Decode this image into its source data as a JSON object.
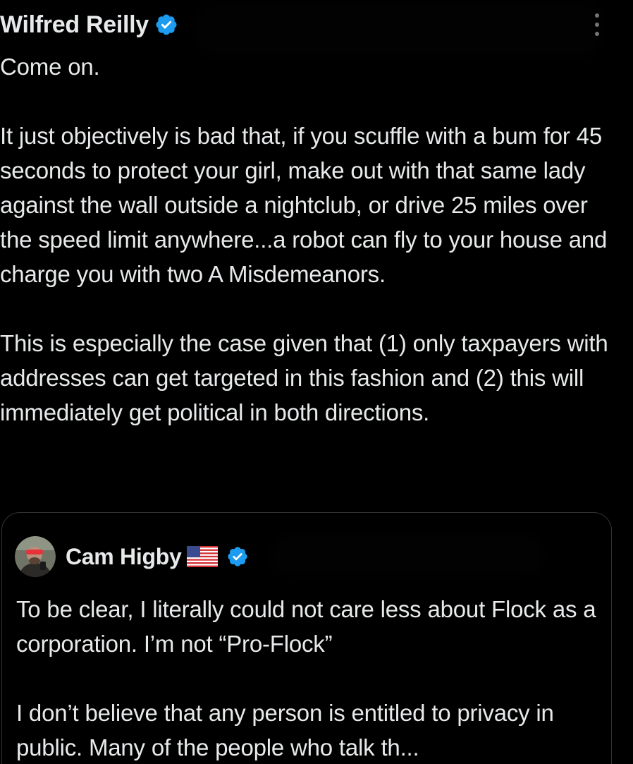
{
  "tweet": {
    "author_name": "Wilfred Reilly",
    "verified_icon": "verified-badge-icon",
    "more_icon": "more-options-icon",
    "text": "Come on.\n\nIt just objectively is bad that, if you scuffle with a bum for 45 seconds to protect your girl, make out with that same lady against the wall outside a nightclub, or drive 25 miles over the speed limit anywhere...a robot can fly to your house and charge you with two A Misdemeanors.\n\nThis is especially the case given that (1) only taxpayers with addresses can get targeted in this fashion and (2) this will immediately get political in both directions."
  },
  "quoted_tweet": {
    "author_name": "Cam Higby",
    "flag_emoji": "🇺🇸",
    "verified_icon": "verified-badge-icon",
    "text": "To be clear, I literally could not care less about Flock as a corporation. I’m not “Pro-Flock”\n\nI don’t believe that any person is entitled to privacy in public. Many of the people who talk th..."
  },
  "colors": {
    "background": "#000000",
    "text": "#e7e9ea",
    "verified_blue": "#1d9bf0",
    "border": "#2f3336"
  }
}
